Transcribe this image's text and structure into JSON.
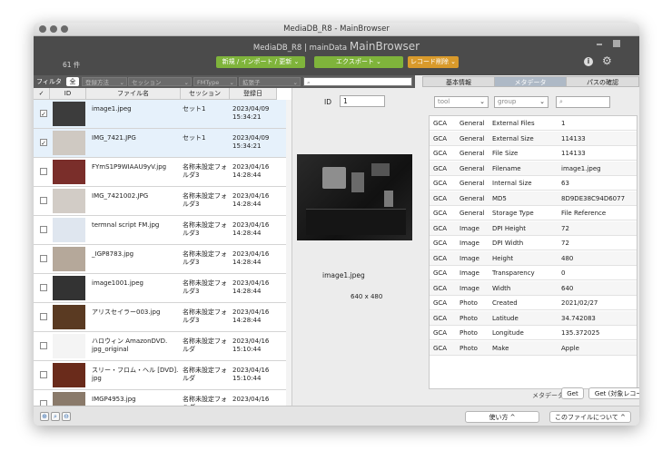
{
  "window": {
    "title": "MediaDB_R8 - MainBrowser"
  },
  "header": {
    "db_name": "MediaDB_R8 | mainData",
    "layout_name": "MainBrowser",
    "record_count": "61 件",
    "btn_new_import": "新規 / インポート / 更新 ⌄",
    "btn_export": "エクスポート ⌄",
    "btn_delete": "レコード削除 ⌄",
    "info_icon": "info-icon",
    "settings_icon": "gear-icon",
    "colors": {
      "green": "#7fb43b",
      "orange": "#d99a2b",
      "header_bg": "#4b4b4b"
    }
  },
  "filterbar": {
    "label": "フィルタ",
    "all": "全",
    "register_method_placeholder": "登録方法",
    "session_placeholder": "セッション",
    "fmtype_placeholder": "FMType",
    "ext_placeholder": "拡張子",
    "search_placeholder": ""
  },
  "list": {
    "columns": [
      "✓",
      "ID",
      "ファイル名",
      "セッション",
      "登録日"
    ],
    "rows": [
      {
        "checked": true,
        "name": "image1.jpeg",
        "session": "セット1",
        "date": "2023/04/09\n15:34:21",
        "thumb": "#3c3c3c",
        "selected": true
      },
      {
        "checked": true,
        "name": "IMG_7421.JPG",
        "session": "セット1",
        "date": "2023/04/09\n15:34:21",
        "thumb": "#cfc9c2",
        "selected": true
      },
      {
        "checked": false,
        "name": "FYmS1P9WIAAU9yV.jpg",
        "session": "名称未設定フォ\nルダ3",
        "date": "2023/04/16\n14:28:44",
        "thumb": "#7a2e2a",
        "selected": false
      },
      {
        "checked": false,
        "name": "IMG_7421002.JPG",
        "session": "名称未設定フォ\nルダ3",
        "date": "2023/04/16\n14:28:44",
        "thumb": "#d2ccc6",
        "selected": false
      },
      {
        "checked": false,
        "name": "termnal script FM.jpg",
        "session": "名称未設定フォ\nルダ3",
        "date": "2023/04/16\n14:28:44",
        "thumb": "#dfe6ef",
        "selected": false
      },
      {
        "checked": false,
        "name": "_IGP8783.jpg",
        "session": "名称未設定フォ\nルダ3",
        "date": "2023/04/16\n14:28:44",
        "thumb": "#b5a89a",
        "selected": false
      },
      {
        "checked": false,
        "name": "image1001.jpeg",
        "session": "名称未設定フォ\nルダ3",
        "date": "2023/04/16\n14:28:44",
        "thumb": "#333333",
        "selected": false
      },
      {
        "checked": false,
        "name": "アリスセイラー003.jpg",
        "session": "名称未設定フォ\nルダ3",
        "date": "2023/04/16\n14:28:44",
        "thumb": "#5a3a22",
        "selected": false
      },
      {
        "checked": false,
        "name": "ハロウィン AmazonDVD.\njpg_original",
        "session": "名称未設定フォ\nルダ",
        "date": "2023/04/16\n15:10:44",
        "thumb": "#f4f4f4",
        "selected": false
      },
      {
        "checked": false,
        "name": "スリー・フロム・ヘル [DVD].\njpg",
        "session": "名称未設定フォ\nルダ",
        "date": "2023/04/16\n15:10:44",
        "thumb": "#6a2b1b",
        "selected": false
      },
      {
        "checked": false,
        "name": "IMGP4953.jpg",
        "session": "名称未設定フォ\nルダ",
        "date": "2023/04/16",
        "thumb": "#8a7a6a",
        "selected": false
      }
    ]
  },
  "preview": {
    "id_label": "ID",
    "id_value": "1",
    "filename": "image1.jpeg",
    "dimensions": "640 x 480"
  },
  "tabs": [
    "基本情報",
    "メタデータ",
    "パスの確認"
  ],
  "meta": {
    "tool_placeholder": "tool",
    "group_placeholder": "group",
    "search_placeholder": "",
    "rows": [
      {
        "tool": "GCA",
        "group": "General",
        "key": "External Files",
        "value": "1"
      },
      {
        "tool": "GCA",
        "group": "General",
        "key": "External Size",
        "value": "114133"
      },
      {
        "tool": "GCA",
        "group": "General",
        "key": "File Size",
        "value": "114133"
      },
      {
        "tool": "GCA",
        "group": "General",
        "key": "Filename",
        "value": "image1.jpeg"
      },
      {
        "tool": "GCA",
        "group": "General",
        "key": "Internal Size",
        "value": "63"
      },
      {
        "tool": "GCA",
        "group": "General",
        "key": "MD5",
        "value": "8D9DE38C94D6077"
      },
      {
        "tool": "GCA",
        "group": "General",
        "key": "Storage Type",
        "value": "File Reference"
      },
      {
        "tool": "GCA",
        "group": "Image",
        "key": "DPI Height",
        "value": "72"
      },
      {
        "tool": "GCA",
        "group": "Image",
        "key": "DPI Width",
        "value": "72"
      },
      {
        "tool": "GCA",
        "group": "Image",
        "key": "Height",
        "value": "480"
      },
      {
        "tool": "GCA",
        "group": "Image",
        "key": "Transparency",
        "value": "0"
      },
      {
        "tool": "GCA",
        "group": "Image",
        "key": "Width",
        "value": "640"
      },
      {
        "tool": "GCA",
        "group": "Photo",
        "key": "Created",
        "value": "2021/02/27"
      },
      {
        "tool": "GCA",
        "group": "Photo",
        "key": "Latitude",
        "value": "34.742083"
      },
      {
        "tool": "GCA",
        "group": "Photo",
        "key": "Longitude",
        "value": "135.372025"
      },
      {
        "tool": "GCA",
        "group": "Photo",
        "key": "Make",
        "value": "Apple"
      }
    ],
    "metadata_label": "メタデータ",
    "get_btn": "Get",
    "get_target_btn": "Get (対象レコード)"
  },
  "bottom": {
    "usage_btn": "使い方 ^",
    "about_btn": "このファイルについて ^"
  }
}
